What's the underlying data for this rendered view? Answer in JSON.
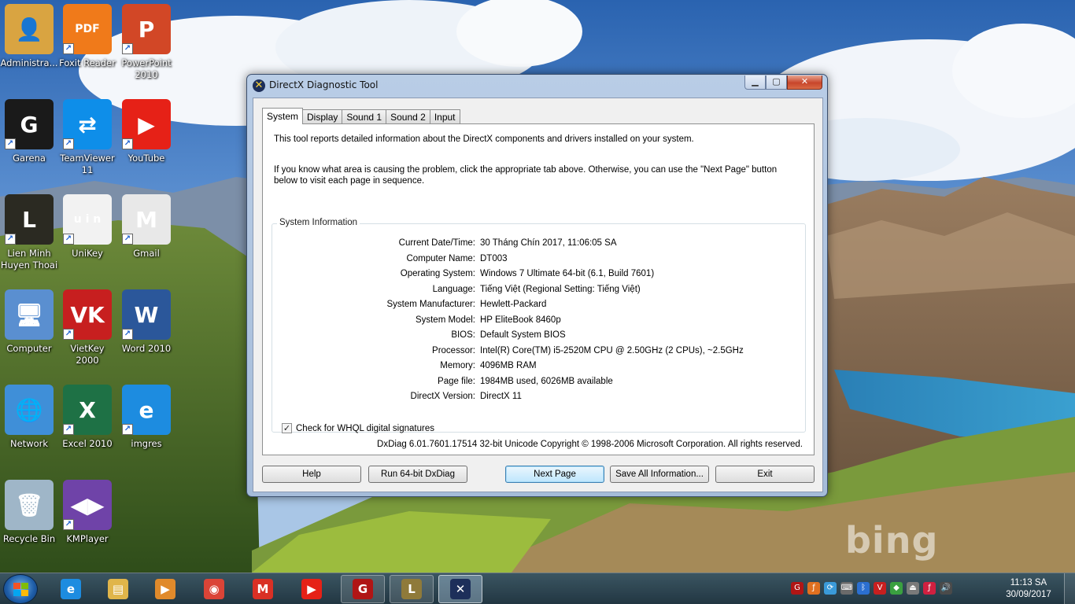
{
  "desktop": {
    "icons": [
      {
        "label": "Administra...",
        "glyph": "👤",
        "icon": "user-folder-icon",
        "color": "#d9a441"
      },
      {
        "label": "Foxit Reader",
        "glyph": "PDF",
        "icon": "foxit-pdf-icon",
        "color": "#f07a1a"
      },
      {
        "label": "PowerPoint 2010",
        "glyph": "P",
        "icon": "powerpoint-icon",
        "color": "#d24726"
      },
      {
        "label": "Garena",
        "glyph": "G",
        "icon": "garena-icon",
        "color": "#1a1a1a"
      },
      {
        "label": "TeamViewer 11",
        "glyph": "⇄",
        "icon": "teamviewer-icon",
        "color": "#0e8ee9"
      },
      {
        "label": "YouTube",
        "glyph": "▶",
        "icon": "youtube-icon",
        "color": "#e62117"
      },
      {
        "label": "Lien Minh Huyen Thoai",
        "glyph": "L",
        "icon": "league-icon",
        "color": "#2b2a22"
      },
      {
        "label": "UniKey",
        "glyph": "u i n",
        "icon": "unikey-icon",
        "color": "#f2f2f2"
      },
      {
        "label": "Gmail",
        "glyph": "M",
        "icon": "gmail-icon",
        "color": "#e8e8e8"
      },
      {
        "label": "Computer",
        "glyph": "🖥",
        "icon": "computer-icon",
        "color": "#5a8fd0"
      },
      {
        "label": "VietKey 2000",
        "glyph": "VK",
        "icon": "vietkey-icon",
        "color": "#c71f1f"
      },
      {
        "label": "Word 2010",
        "glyph": "W",
        "icon": "word-icon",
        "color": "#2b579a"
      },
      {
        "label": "Network",
        "glyph": "🌐",
        "icon": "network-icon",
        "color": "#3f8fd8"
      },
      {
        "label": "Excel 2010",
        "glyph": "X",
        "icon": "excel-icon",
        "color": "#1e7145"
      },
      {
        "label": "imgres",
        "glyph": "e",
        "icon": "internet-explorer-icon",
        "color": "#1d8ce0"
      },
      {
        "label": "Recycle Bin",
        "glyph": "🗑",
        "icon": "recycle-bin-icon",
        "color": "#9fb6c8"
      },
      {
        "label": "KMPlayer",
        "glyph": "◀▶",
        "icon": "kmplayer-icon",
        "color": "#6f43a8"
      }
    ],
    "watermark": "bing"
  },
  "window": {
    "title": "DirectX Diagnostic Tool",
    "caption": {
      "minimize": "▁",
      "maximize": "▢",
      "close": "✕"
    },
    "tabs": [
      "System",
      "Display",
      "Sound 1",
      "Sound 2",
      "Input"
    ],
    "active_tab": "System",
    "intro": "This tool reports detailed information about the DirectX components and drivers installed on your system.",
    "instructions": "If you know what area is causing the problem, click the appropriate tab above.  Otherwise, you can use the \"Next Page\" button below to visit each page in sequence.",
    "system_info": {
      "title": "System Information",
      "rows": [
        {
          "label": "Current Date/Time:",
          "value": "30 Tháng Chín 2017, 11:06:05 SA"
        },
        {
          "label": "Computer Name:",
          "value": "DT003"
        },
        {
          "label": "Operating System:",
          "value": "Windows 7 Ultimate 64-bit (6.1, Build 7601)"
        },
        {
          "label": "Language:",
          "value": "Tiếng Việt (Regional Setting: Tiếng Việt)"
        },
        {
          "label": "System Manufacturer:",
          "value": "Hewlett-Packard"
        },
        {
          "label": "System Model:",
          "value": "HP EliteBook 8460p"
        },
        {
          "label": "BIOS:",
          "value": "Default System BIOS"
        },
        {
          "label": "Processor:",
          "value": "Intel(R) Core(TM) i5-2520M CPU @ 2.50GHz (2 CPUs), ~2.5GHz"
        },
        {
          "label": "Memory:",
          "value": "4096MB RAM"
        },
        {
          "label": "Page file:",
          "value": "1984MB used, 6026MB available"
        },
        {
          "label": "DirectX Version:",
          "value": "DirectX 11"
        }
      ],
      "whql_checkbox": {
        "label": "Check for WHQL digital signatures",
        "checked": true
      }
    },
    "copyright": "DxDiag 6.01.7601.17514 32-bit Unicode  Copyright © 1998-2006 Microsoft Corporation.  All rights reserved.",
    "buttons": {
      "help": "Help",
      "run64": "Run 64-bit DxDiag",
      "next_page": "Next Page",
      "save_all": "Save All Information...",
      "exit": "Exit"
    }
  },
  "taskbar": {
    "items": [
      {
        "name": "internet-explorer",
        "glyph": "e",
        "color": "#1d8ce0",
        "state": "pinned"
      },
      {
        "name": "file-explorer",
        "glyph": "▤",
        "color": "#e0b54a",
        "state": "pinned"
      },
      {
        "name": "media-player",
        "glyph": "▶",
        "color": "#e08a2b",
        "state": "pinned"
      },
      {
        "name": "chrome",
        "glyph": "◉",
        "color": "#db4437",
        "state": "pinned"
      },
      {
        "name": "gmail",
        "glyph": "M",
        "color": "#d93025",
        "state": "pinned"
      },
      {
        "name": "youtube",
        "glyph": "▶",
        "color": "#e62117",
        "state": "pinned"
      },
      {
        "name": "garena",
        "glyph": "G",
        "color": "#b01515",
        "state": "open"
      },
      {
        "name": "league-of-legends",
        "glyph": "L",
        "color": "#8f7a3a",
        "state": "open"
      },
      {
        "name": "directx-diagnostic",
        "glyph": "✕",
        "color": "#1d2f5a",
        "state": "active"
      }
    ],
    "tray_icons": [
      "garena",
      "flash",
      "network-sync",
      "keyboard",
      "bluetooth",
      "vietkey",
      "defender",
      "usb",
      "flash-red",
      "volume"
    ],
    "clock": {
      "time": "11:13 SA",
      "date": "30/09/2017"
    }
  }
}
